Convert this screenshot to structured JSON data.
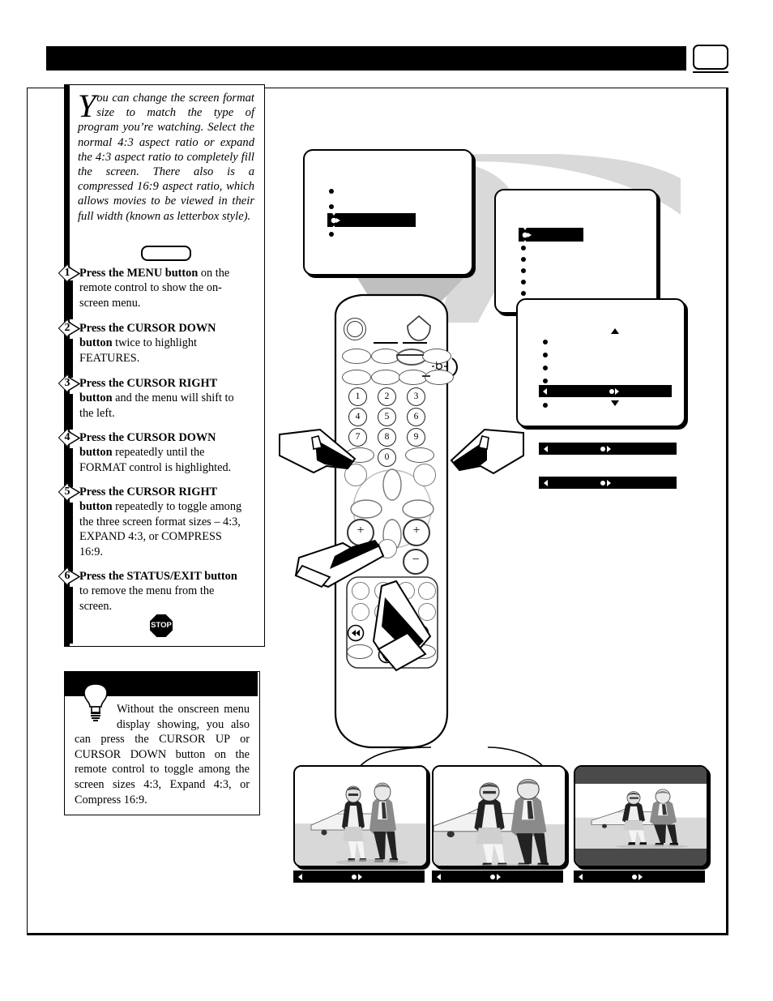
{
  "header": {
    "title": "",
    "page_icon": "tv-screen-icon"
  },
  "intro": {
    "dropcap": "Y",
    "text": "ou can change the screen format size to match the type of program you’re watching. Select the normal 4:3 aspect ratio or expand the 4:3 aspect ratio to completely fill the screen. There also is a compressed 16:9 aspect ratio, which allows movies to be viewed in their full width (known as letterbox style)."
  },
  "steps": [
    {
      "num": "1",
      "bold": "Press the MENU button",
      "rest": " on the remote control to show the on-screen menu."
    },
    {
      "num": "2",
      "bold": "Press the CURSOR DOWN button",
      "rest": " twice to highlight FEATURES."
    },
    {
      "num": "3",
      "bold": "Press the CURSOR RIGHT button",
      "rest": " and the menu will shift to the left."
    },
    {
      "num": "4",
      "bold": "Press the CURSOR DOWN button",
      "rest": " repeatedly until the FORMAT control is highlighted."
    },
    {
      "num": "5",
      "bold": "Press the CURSOR RIGHT button",
      "rest": " repeatedly to toggle among the three screen format sizes – 4:3, EXPAND 4:3, or COMPRESS 16:9."
    },
    {
      "num": "6",
      "bold": "Press the STATUS/EXIT button",
      "rest": " to remove the menu from the screen."
    }
  ],
  "stop_sign": {
    "label": "STOP"
  },
  "tip": {
    "icon": "lightbulb-icon",
    "text": "Without the onscreen menu display showing, you also can press the CURSOR UP or CURSOR DOWN button on the remote control to toggle among the screen sizes 4:3, Expand 4:3, or Compress 16:9."
  },
  "menus": {
    "screen1": {
      "items": [
        "",
        "",
        "",
        ""
      ],
      "highlighted_index": 2,
      "highlight_label": ""
    },
    "screen2": {
      "items": [
        "",
        "",
        "",
        "",
        "",
        ""
      ],
      "highlighted_index": 0,
      "highlight_label": ""
    },
    "screen3": {
      "items": [
        "",
        "",
        "",
        "",
        "",
        ""
      ],
      "highlighted_index": 4,
      "highlight_label": "",
      "scroll_up": "▲",
      "scroll_down": "▼"
    }
  },
  "format_bars": [
    {
      "label": ""
    },
    {
      "label": ""
    }
  ],
  "samples": [
    {
      "name": "normal-4-3",
      "label": "",
      "mode": "normal"
    },
    {
      "name": "expand-4-3",
      "label": "",
      "mode": "expand"
    },
    {
      "name": "compress-16-9",
      "label": "",
      "mode": "letterbox"
    }
  ],
  "remote": {
    "numeric_keys": [
      "1",
      "2",
      "3",
      "4",
      "5",
      "6",
      "7",
      "8",
      "9",
      "0"
    ],
    "ir_icon": "ir-emitter-icon",
    "volume_up": "+",
    "channel_up": "+",
    "minus": "−",
    "transport": {
      "rewind": "◀◀",
      "stop": "■",
      "forward": "▶▶",
      "pause": "❚❚"
    }
  },
  "colors": {
    "ink": "#000000",
    "swoosh": "#d9d9d9",
    "photo_bg": "#d8d8d8",
    "letterbox": "#4a4a4a"
  }
}
